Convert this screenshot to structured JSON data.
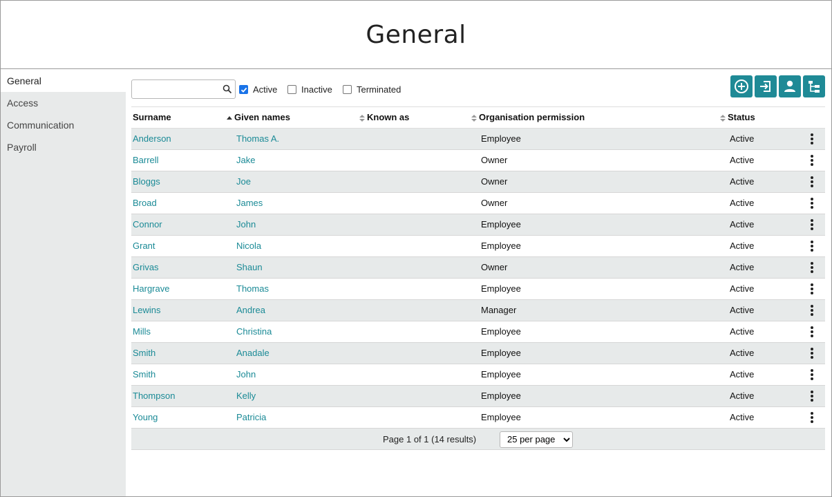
{
  "page_title": "General",
  "sidebar": {
    "items": [
      {
        "label": "General"
      },
      {
        "label": "Access"
      },
      {
        "label": "Communication"
      },
      {
        "label": "Payroll"
      }
    ]
  },
  "search": {
    "placeholder": "",
    "value": ""
  },
  "filters": {
    "active": {
      "label": "Active",
      "checked": true
    },
    "inactive": {
      "label": "Inactive",
      "checked": false
    },
    "terminated": {
      "label": "Terminated",
      "checked": false
    }
  },
  "toolbar_icons": [
    "add-circle-icon",
    "import-icon",
    "person-icon",
    "org-chart-icon"
  ],
  "table": {
    "columns": [
      "Surname",
      "Given names",
      "Known as",
      "Organisation permission",
      "Status"
    ],
    "sorted_column": "Surname",
    "rows": [
      {
        "surname": "Anderson",
        "given": "Thomas A.",
        "known": "",
        "permission": "Employee",
        "status": "Active"
      },
      {
        "surname": "Barrell",
        "given": "Jake",
        "known": "",
        "permission": "Owner",
        "status": "Active"
      },
      {
        "surname": "Bloggs",
        "given": "Joe",
        "known": "",
        "permission": "Owner",
        "status": "Active"
      },
      {
        "surname": "Broad",
        "given": "James",
        "known": "",
        "permission": "Owner",
        "status": "Active"
      },
      {
        "surname": "Connor",
        "given": "John",
        "known": "",
        "permission": "Employee",
        "status": "Active"
      },
      {
        "surname": "Grant",
        "given": "Nicola",
        "known": "",
        "permission": "Employee",
        "status": "Active"
      },
      {
        "surname": "Grivas",
        "given": "Shaun",
        "known": "",
        "permission": "Owner",
        "status": "Active"
      },
      {
        "surname": "Hargrave",
        "given": "Thomas",
        "known": "",
        "permission": "Employee",
        "status": "Active"
      },
      {
        "surname": "Lewins",
        "given": "Andrea",
        "known": "",
        "permission": "Manager",
        "status": "Active"
      },
      {
        "surname": "Mills",
        "given": "Christina",
        "known": "",
        "permission": "Employee",
        "status": "Active"
      },
      {
        "surname": "Smith",
        "given": "Anadale",
        "known": "",
        "permission": "Employee",
        "status": "Active"
      },
      {
        "surname": "Smith",
        "given": "John",
        "known": "",
        "permission": "Employee",
        "status": "Active"
      },
      {
        "surname": "Thompson",
        "given": "Kelly",
        "known": "",
        "permission": "Employee",
        "status": "Active"
      },
      {
        "surname": "Young",
        "given": "Patricia",
        "known": "",
        "permission": "Employee",
        "status": "Active"
      }
    ]
  },
  "pagination": {
    "info": "Page 1 of 1 (14 results)",
    "per_page": "25 per page",
    "options": [
      "25 per page"
    ]
  },
  "colors": {
    "accent": "#1f8a96",
    "link": "#1a8a96",
    "row_alt": "#e7eaea",
    "sidebar_bg": "#e8eaea"
  }
}
